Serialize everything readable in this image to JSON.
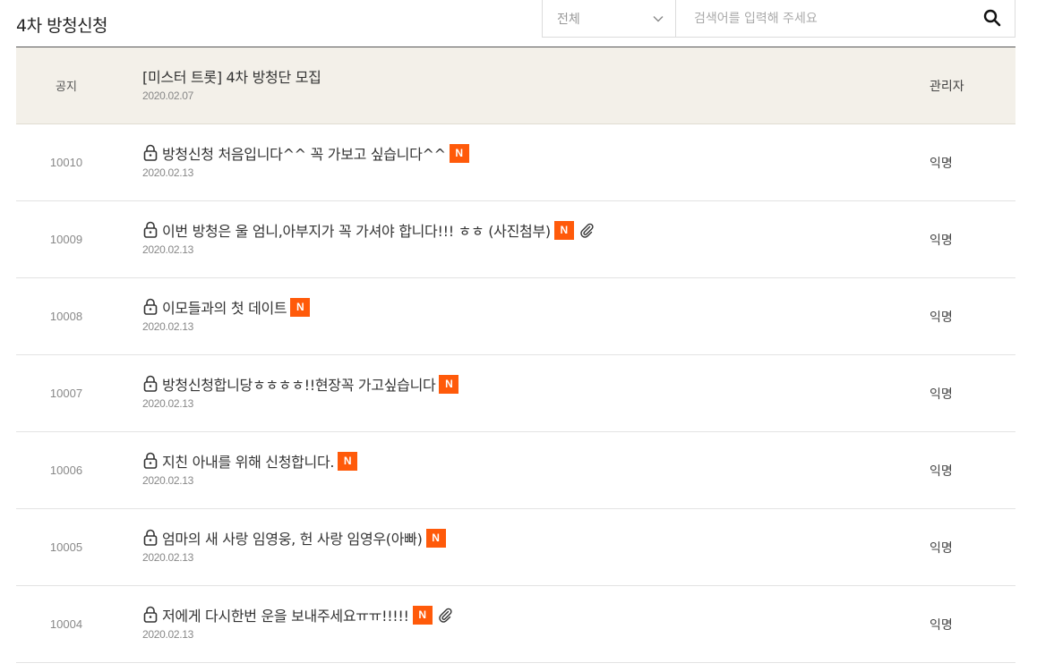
{
  "page": {
    "title": "4차 방청신청"
  },
  "search": {
    "category_selected": "전체",
    "placeholder": "검색어를 입력해 주세요",
    "value": ""
  },
  "badge": {
    "new_label": "N"
  },
  "notice": {
    "label": "공지",
    "title": "[미스터 트롯] 4차 방청단 모집",
    "date": "2020.02.07",
    "author": "관리자"
  },
  "posts": [
    {
      "num": "10010",
      "title": "방청신청 처음입니다^^ 꼭 가보고 싶습니다^^",
      "date": "2020.02.13",
      "author": "익명"
    },
    {
      "num": "10009",
      "title": "이번 방청은 울 엄니,아부지가 꼭 가셔야 합니다!!! ㅎㅎ (사진첨부)",
      "date": "2020.02.13",
      "author": "익명"
    },
    {
      "num": "10008",
      "title": "이모들과의 첫 데이트",
      "date": "2020.02.13",
      "author": "익명"
    },
    {
      "num": "10007",
      "title": "방청신청합니당ㅎㅎㅎㅎ!!현장꼭 가고싶습니다",
      "date": "2020.02.13",
      "author": "익명"
    },
    {
      "num": "10006",
      "title": "지친 아내를 위해 신청합니다.",
      "date": "2020.02.13",
      "author": "익명"
    },
    {
      "num": "10005",
      "title": "엄마의 새 사랑 임영웅, 헌 사랑 임영우(아빠)",
      "date": "2020.02.13",
      "author": "익명"
    },
    {
      "num": "10004",
      "title": "저에게 다시한번 운을 보내주세요ㅠㅠ!!!!!",
      "date": "2020.02.13",
      "author": "익명"
    }
  ],
  "colors": {
    "new_badge": "#ff5a0a",
    "notice_bg": "#f3f0e9"
  }
}
